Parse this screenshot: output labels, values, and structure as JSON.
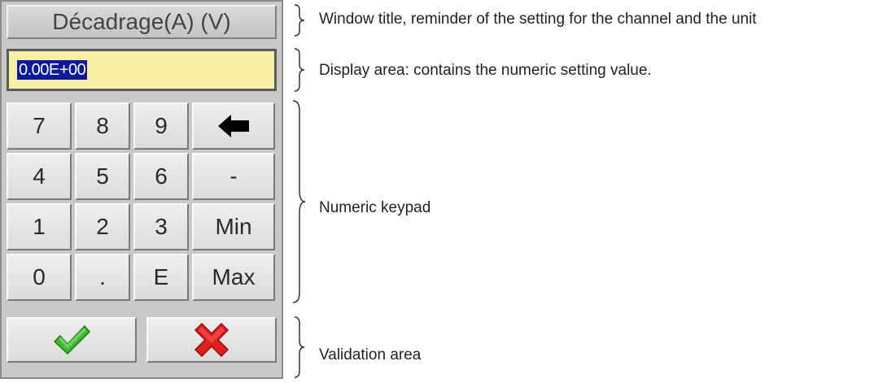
{
  "dialog": {
    "title": "Décadrage(A) (V)",
    "display_value": "0.00E+00",
    "keypad": {
      "keys": [
        "7",
        "8",
        "9",
        "backspace",
        "4",
        "5",
        "6",
        "-",
        "1",
        "2",
        "3",
        "Min",
        "0",
        ".",
        "E",
        "Max"
      ],
      "row1": {
        "k1": "7",
        "k2": "8",
        "k3": "9"
      },
      "row2": {
        "k1": "4",
        "k2": "5",
        "k3": "6",
        "k4": "-"
      },
      "row3": {
        "k1": "1",
        "k2": "2",
        "k3": "3",
        "k4": "Min"
      },
      "row4": {
        "k1": "0",
        "k2": ".",
        "k3": "E",
        "k4": "Max"
      },
      "backspace_icon": "arrow-left-icon"
    },
    "validation": {
      "ok_icon": "checkmark-icon",
      "cancel_icon": "cross-icon"
    }
  },
  "annotations": {
    "title": "Window title, reminder of the setting for the channel and the unit",
    "display": "Display area: contains the numeric setting value.",
    "keypad": "Numeric keypad",
    "validation": "Validation area"
  },
  "colors": {
    "dialog_bg": "#c9c9c9",
    "display_bg": "#f7f0a4",
    "selection_bg": "#0a1a9b",
    "check_green": "#3cb82e",
    "cross_red": "#e01e1e"
  }
}
